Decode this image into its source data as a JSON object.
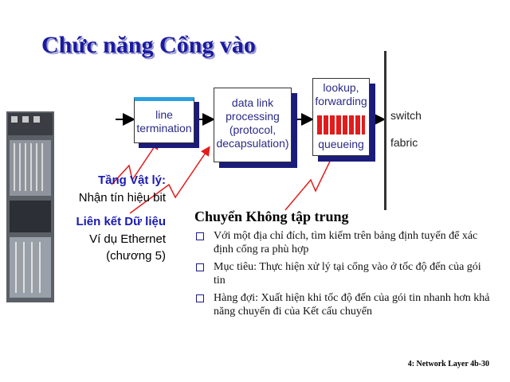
{
  "slide": {
    "title": "Chức năng Cổng vào",
    "diagram": {
      "line_termination": "line\ntermination",
      "data_link_processing": "data link\nprocessing\n(protocol,\ndecapsulation)",
      "lookup_forwarding": "lookup,\nforwarding",
      "queueing": "queueing",
      "switch_fabric": "switch\nfabric"
    },
    "left_labels": {
      "physical_layer": "Tầng Vật lý:",
      "receive_bits": "Nhận tín hiệu bit",
      "data_link": "Liên kết Dữ liệu",
      "ethernet_example": "Ví dụ Ethernet",
      "chapter": "(chương 5)"
    },
    "heading": "Chuyển Không tập trung",
    "bullets": [
      "Với một địa chỉ đích, tìm kiếm trên bảng định tuyến để xác định cổng ra phù hợp",
      "Mục tiêu: Thực hiện xử lý tại cổng vào ở tốc độ đến của gói tin",
      "Hàng đợi: Xuất hiện khi tốc độ đến của gói tin nhanh hơn khả năng chuyển đi của Kết cấu chuyển"
    ],
    "footer": "4: Network Layer   4b-30"
  },
  "colors": {
    "title": "#1a1aa0",
    "shadow": "#1b1b7a",
    "accent_red": "#e21b1b",
    "accent_blue": "#2aa0e0"
  }
}
